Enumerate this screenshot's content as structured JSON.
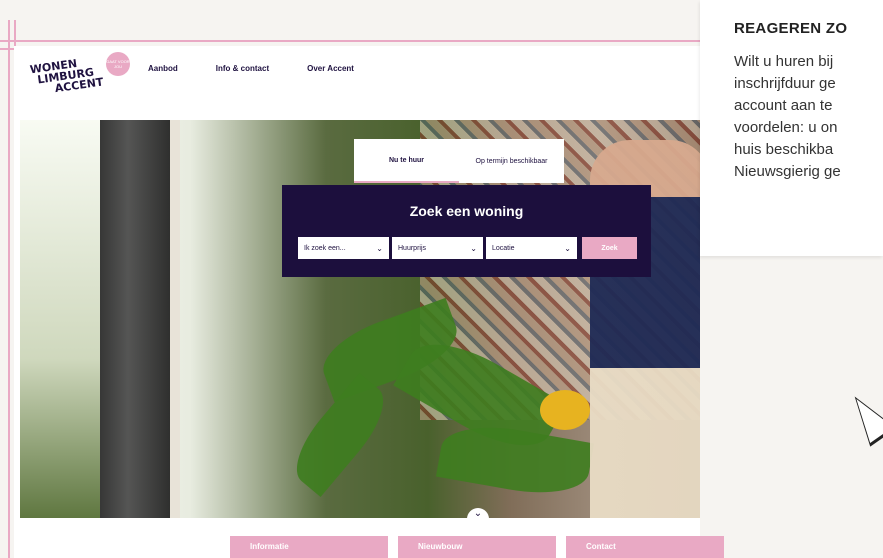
{
  "logo": {
    "line1": "WONEN",
    "line2": "LIMBURG",
    "line3": "ACCENT",
    "badge": "GAAT VOOR JOU"
  },
  "nav": [
    "Aanbod",
    "Info & contact",
    "Over Accent"
  ],
  "tabs": [
    {
      "label": "Nu te huur",
      "active": true
    },
    {
      "label": "Op termijn beschikbaar",
      "active": false
    }
  ],
  "search": {
    "title": "Zoek een woning",
    "fields": [
      "Ik zoek een...",
      "Huurprijs",
      "Locatie"
    ],
    "button": "Zoek"
  },
  "scroll_icon": "chevron-down-icon",
  "bottom_tiles": [
    "Informatie",
    "Nieuwbouw",
    "Contact"
  ],
  "notice": {
    "heading": "REAGEREN ZO",
    "lines": [
      "Wilt u huren bij",
      "inschrijfduur ge",
      "account aan te",
      "voordelen: u on",
      "huis beschikba",
      "Nieuwsgierig ge"
    ]
  },
  "colors": {
    "accent_pink": "#e9a9c4",
    "navy": "#1c0f3d",
    "text_dark": "#1f1240"
  }
}
